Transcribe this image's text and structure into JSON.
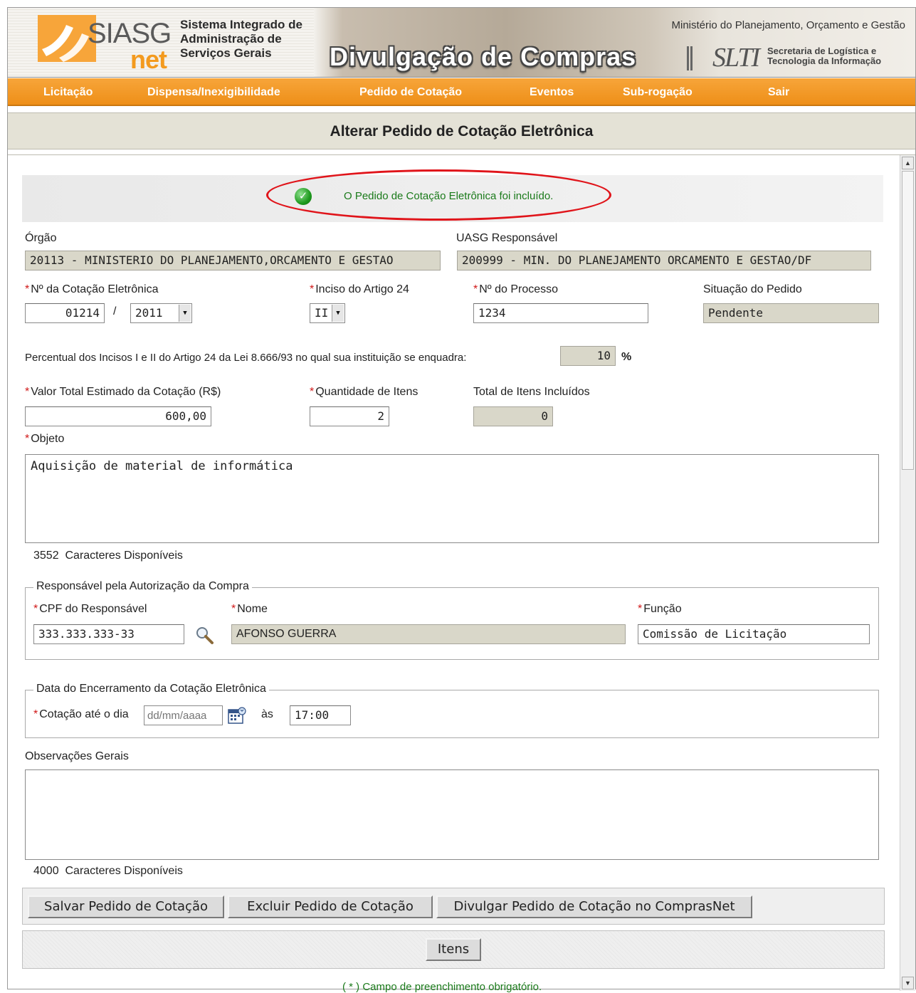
{
  "header": {
    "logo_main": "SIASG",
    "logo_sub": "net",
    "system_title_lines": [
      "Sistema Integrado de",
      "Administração de",
      "Serviços Gerais"
    ],
    "banner_title": "Divulgação de Compras",
    "ministry": "Ministério do Planejamento, Orçamento e Gestão",
    "slti": "SLTI",
    "secretaria_lines": [
      "Secretaria de Logística e",
      "Tecnologia da Informação"
    ]
  },
  "nav": {
    "items": [
      "Licitação",
      "Dispensa/Inexigibilidade",
      "Pedido de Cotação",
      "Eventos",
      "Sub-rogação",
      "Sair"
    ]
  },
  "page_title": "Alterar Pedido de Cotação Eletrônica",
  "message": "O Pedido de Cotação Eletrônica foi incluído.",
  "orgao": {
    "label": "Órgão",
    "value": "20113 - MINISTERIO DO PLANEJAMENTO,ORCAMENTO E GESTAO"
  },
  "uasg": {
    "label": "UASG Responsável",
    "value": "200999 - MIN. DO PLANEJAMENTO ORCAMENTO E GESTAO/DF"
  },
  "cotacao": {
    "label": "Nº da Cotação Eletrônica",
    "number": "01214",
    "separator": "/",
    "year": "2011"
  },
  "inciso": {
    "label": "Inciso do Artigo 24",
    "value": "II"
  },
  "processo": {
    "label": "Nº do Processo",
    "value": "1234"
  },
  "situacao": {
    "label": "Situação do Pedido",
    "value": "Pendente"
  },
  "percentual": {
    "label": "Percentual dos Incisos I e II do Artigo 24 da Lei 8.666/93 no qual sua instituição se enquadra:",
    "value": "10",
    "unit": "%"
  },
  "valor_total": {
    "label": "Valor Total Estimado da Cotação (R$)",
    "value": "600,00"
  },
  "quantidade": {
    "label": "Quantidade de Itens",
    "value": "2"
  },
  "total_incluidos": {
    "label": "Total de Itens Incluídos",
    "value": "0"
  },
  "objeto": {
    "label": "Objeto",
    "value": "Aquisição de material de informática",
    "remaining_count": "3552",
    "remaining_label": "Caracteres Disponíveis"
  },
  "responsavel": {
    "legend": "Responsável pela Autorização da Compra",
    "cpf_label": "CPF do Responsável",
    "cpf_value": "333.333.333-33",
    "nome_label": "Nome",
    "nome_value": "AFONSO GUERRA",
    "funcao_label": "Função",
    "funcao_value": "Comissão de Licitação"
  },
  "encerramento": {
    "legend": "Data do Encerramento da Cotação Eletrônica",
    "label": "Cotação até o dia",
    "date_placeholder": "dd/mm/aaaa",
    "as": "às",
    "time": "17:00"
  },
  "observacoes": {
    "label": "Observações Gerais",
    "value": "",
    "remaining_count": "4000",
    "remaining_label": "Caracteres Disponíveis"
  },
  "buttons": {
    "salvar": "Salvar Pedido de Cotação",
    "excluir": "Excluir Pedido de Cotação",
    "divulgar": "Divulgar Pedido de Cotação no ComprasNet",
    "itens": "Itens"
  },
  "required_note": "( * ) Campo de preenchimento obrigatório.",
  "required_marker": "*",
  "colors": {
    "nav_orange": "#ee8f18",
    "title_bg": "#e4e2d6",
    "readonly_bg": "#d9d7c9",
    "success_green": "#1a7a1a",
    "highlight_red": "#e0141a"
  },
  "icons": [
    "check-circle-icon",
    "magnifier-icon",
    "calendar-icon",
    "scroll-up-icon",
    "scroll-down-icon"
  ]
}
